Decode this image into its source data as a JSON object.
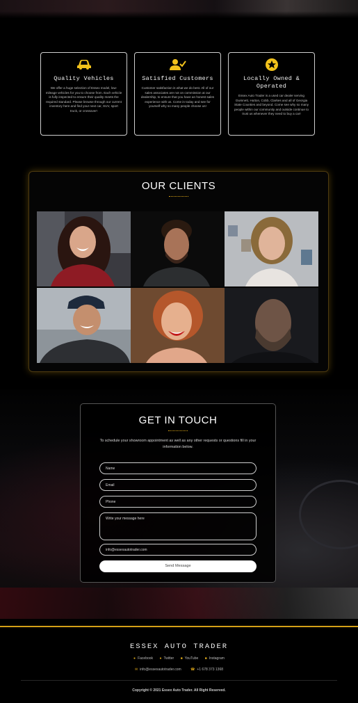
{
  "colors": {
    "accent": "#d4a017",
    "background": "#000000",
    "button": "#ffffff"
  },
  "features": [
    {
      "icon": "car-icon",
      "title": "Quality Vehicles",
      "description": "We offer a huge selection of Essex model, low-mileage vehicles for you to choose from. Each vehicle is fully inspected to ensure their quality meets the required standard. Please browse through our current inventory here and find your next car, SUV, sport truck, or crossover!"
    },
    {
      "icon": "user-check-icon",
      "title": "Satisfied Customers",
      "description": "Customer satisfaction is what we do best. All of our sales associates are not on commission at our dealership, to ensure that you have an honest sales experience with us. Come in today and see for yourself why so many people choose us!"
    },
    {
      "icon": "star-badge-icon",
      "title": "Locally Owned & Operated",
      "description": "Essex Auto Trader is a used car dealer serving Gwinnett, Hutton, Cobb, Clarkes and all of Georgia State Counties and beyond. Come see why so many people within our community and outside continue to trust us whenever they need to buy a car!"
    }
  ],
  "clients": {
    "title": "OUR CLIENTS"
  },
  "contact": {
    "title": "GET IN TOUCH",
    "intro": "To schedule your showroom appointment as well as any other requests or questions fill in your information below.",
    "fields": {
      "name": "Name",
      "email": "Email",
      "phone": "Phone",
      "message": "Write your message here",
      "recipient": "info@essexautotrader.com"
    },
    "send_label": "Send Message"
  },
  "footer": {
    "brand": "ESSEX AUTO TRADER",
    "social": [
      "Facebook",
      "Twitter",
      "YouTube",
      "Instagram"
    ],
    "email": "info@essexautotrader.com",
    "phone": "+1 678 373 1368",
    "copyright": "Copyright © 2021 Essex Auto Trader. All Right Reserved."
  }
}
